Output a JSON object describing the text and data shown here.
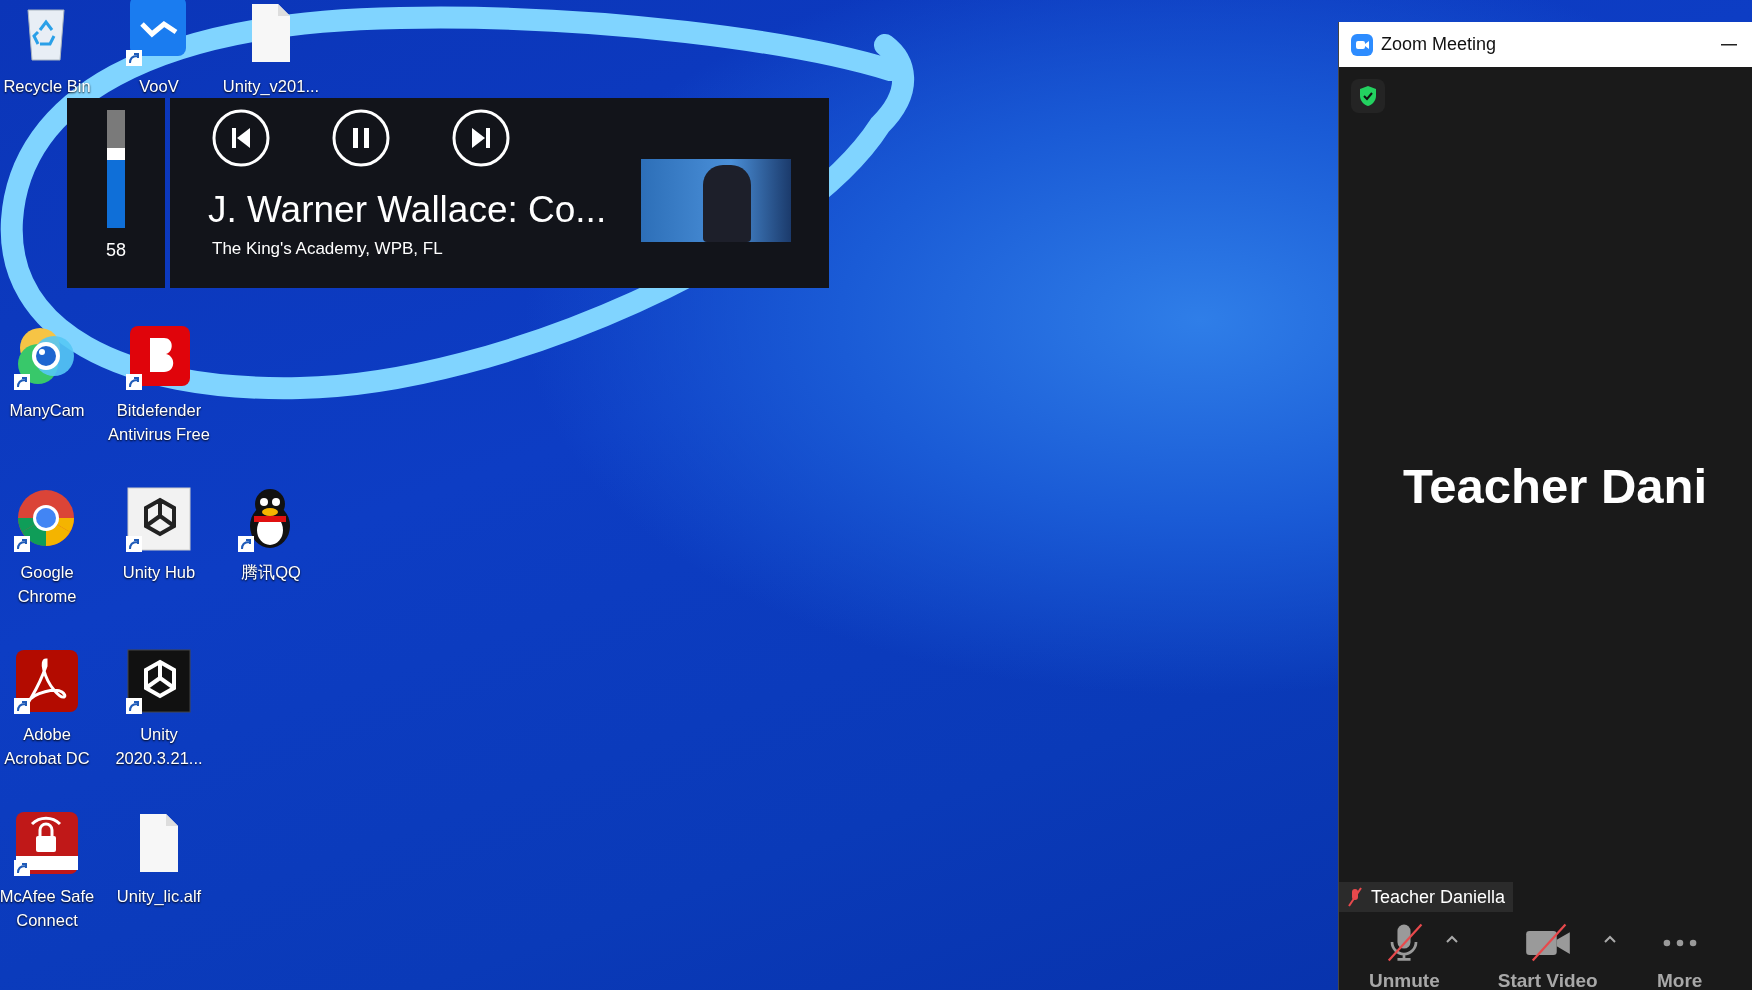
{
  "desktop": {
    "icon_rows": [
      [
        {
          "kind": "recycle-bin",
          "label": "Recycle Bin",
          "shortcut": false
        },
        {
          "kind": "voov",
          "label": "VooV",
          "shortcut": true
        },
        {
          "kind": "file",
          "label": "Unity_v201...",
          "shortcut": false
        }
      ],
      [
        {
          "kind": "manycam",
          "label": "ManyCam",
          "shortcut": true
        },
        {
          "kind": "bitdefender",
          "label": "Bitdefender Antivirus Free",
          "shortcut": true
        }
      ],
      [
        {
          "kind": "chrome",
          "label": "Google Chrome",
          "shortcut": true
        },
        {
          "kind": "unity-hub",
          "label": "Unity Hub",
          "shortcut": true
        },
        {
          "kind": "qq",
          "label": "腾讯QQ",
          "shortcut": true
        }
      ],
      [
        {
          "kind": "acrobat",
          "label": "Adobe Acrobat DC",
          "shortcut": true
        },
        {
          "kind": "unity",
          "label": "Unity 2020.3.21...",
          "shortcut": true
        }
      ],
      [
        {
          "kind": "mcafee",
          "label": "McAfee Safe Connect",
          "shortcut": true
        },
        {
          "kind": "file",
          "label": "Unity_lic.alf",
          "shortcut": false
        }
      ]
    ]
  },
  "media_overlay": {
    "volume": {
      "level": 0.58,
      "reading": "58"
    },
    "controls": [
      {
        "kind": "previous"
      },
      {
        "kind": "pause"
      },
      {
        "kind": "next"
      }
    ],
    "title": "J. Warner Wallace: Co...",
    "subtitle": "The King's Academy, WPB, FL"
  },
  "zoom_window": {
    "title": "Zoom Meeting",
    "speaker_name": "Teacher Dani",
    "name_tag": {
      "name": "Teacher Daniella",
      "muted": true
    },
    "toolbar": [
      {
        "kind": "mic",
        "label": "Unmute",
        "slashed": true,
        "menu": true
      },
      {
        "kind": "video",
        "label": "Start Video",
        "slashed": true,
        "menu": true
      },
      {
        "kind": "more",
        "label": "More",
        "slashed": false,
        "menu": false
      }
    ]
  }
}
